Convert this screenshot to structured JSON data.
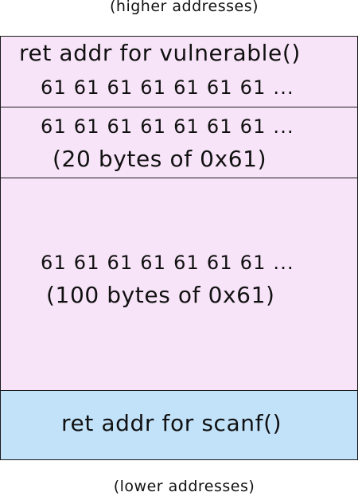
{
  "captions": {
    "top": "(higher addresses)",
    "bottom": "(lower addresses)"
  },
  "blocks": [
    {
      "lines": [
        "ret addr for vulnerable()",
        "61 61 61 61 61 61 61 ..."
      ],
      "color": "#f8e4f8"
    },
    {
      "lines": [
        "61 61 61 61 61 61 61 ...",
        "(20 bytes of 0x61)"
      ],
      "color": "#f8e4f8"
    },
    {
      "lines": [
        "61 61 61 61 61 61 61 ...",
        "(100 bytes of 0x61)"
      ],
      "color": "#f8e4f8"
    },
    {
      "lines": [
        "ret addr for scanf()"
      ],
      "color": "#c2e2fa"
    }
  ]
}
